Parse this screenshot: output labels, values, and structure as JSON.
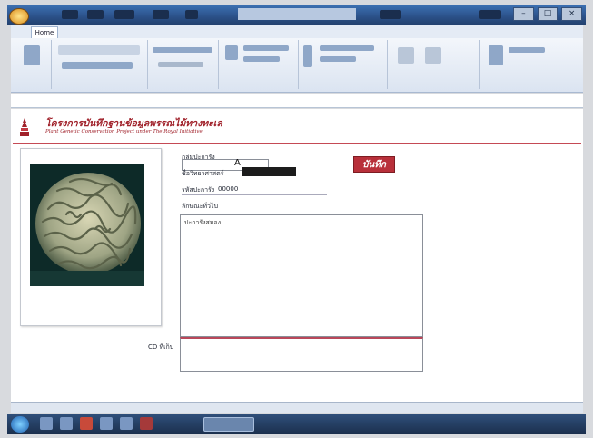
{
  "window": {
    "title": "",
    "controls": [
      "–",
      "□",
      "×"
    ]
  },
  "ribbon": {
    "active_tab": "Home"
  },
  "header": {
    "title": "โครงการบันทึกฐานข้อมูลพรรณไม้ทางทะเล",
    "subtitle": "Plant Genetic Conservation Project under The Royal Initiative"
  },
  "form": {
    "group_label": "กลุ่มปะการัง",
    "group_value": "A",
    "scientific_name_label": "ชื่อวิทยาศาสตร์",
    "code_label": "รหัสปะการัง",
    "code_value": "00000",
    "detail_label": "ลักษณะทั่วไป",
    "detail_text": "ปะการังสมอง",
    "cd_label": "CD ที่เก็บ",
    "save_label": "บันทึก"
  },
  "colors": {
    "brand_red": "#a0212a",
    "save_button": "#b8303a"
  }
}
